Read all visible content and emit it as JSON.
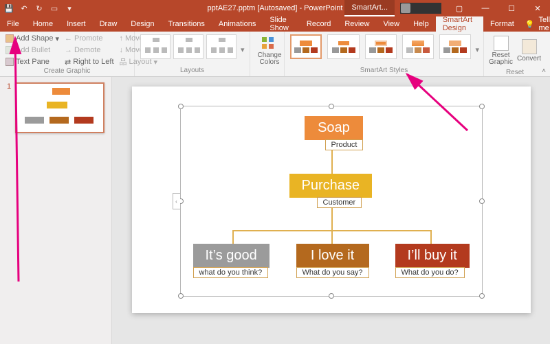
{
  "title": "pptAE27.pptm [Autosaved] - PowerPoint",
  "context_tab": "SmartArt...",
  "tabs": [
    "File",
    "Home",
    "Insert",
    "Draw",
    "Design",
    "Transitions",
    "Animations",
    "Slide Show",
    "Record",
    "Review",
    "View",
    "Help",
    "SmartArt Design",
    "Format"
  ],
  "tellme": "Tell me",
  "ribbon": {
    "create_graphic": {
      "label": "Create Graphic",
      "add_shape": "Add Shape",
      "add_bullet": "Add Bullet",
      "text_pane": "Text Pane",
      "promote": "Promote",
      "demote": "Demote",
      "right_to_left": "Right to Left",
      "move_up": "Move Up",
      "move_down": "Move Down",
      "layout": "Layout"
    },
    "layouts": {
      "label": "Layouts"
    },
    "change_colors": "Change Colors",
    "styles": {
      "label": "SmartArt Styles"
    },
    "reset": {
      "label": "Reset",
      "reset_graphic": "Reset Graphic",
      "convert": "Convert"
    }
  },
  "thumb_number": "1",
  "smartart": {
    "n1": {
      "title": "Soap",
      "sub": "Product",
      "color": "#ed8b3b"
    },
    "n2": {
      "title": "Purchase",
      "sub": "Customer",
      "color": "#e9b424"
    },
    "n3": {
      "title": "It’s good",
      "sub": "what do you think?",
      "color": "#9b9b9b"
    },
    "n4": {
      "title": "I love it",
      "sub": "What do you say?",
      "color": "#b4691e"
    },
    "n5": {
      "title": "I’ll buy it",
      "sub": "What do you do?",
      "color": "#b33a1e"
    }
  }
}
